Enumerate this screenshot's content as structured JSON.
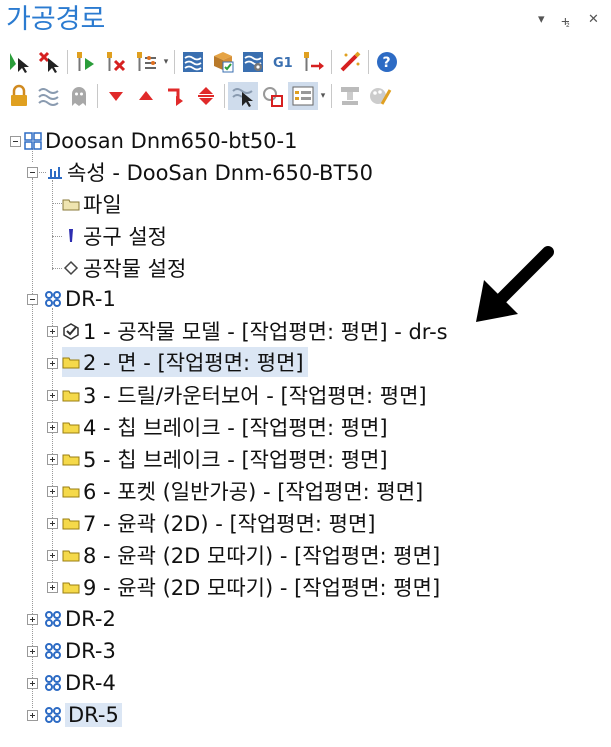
{
  "window": {
    "title": "가공경로",
    "controls": [
      "▾",
      "⨧",
      "✕"
    ]
  },
  "tree": {
    "root": {
      "label": "Doosan Dnm650-bt50-1"
    },
    "properties": {
      "label": "속성 - DooSan Dnm-650-BT50"
    },
    "files": {
      "label": "파일"
    },
    "tool_settings": {
      "label": "공구 설정"
    },
    "stock_settings": {
      "label": "공작물 설정"
    },
    "groups": [
      {
        "label": "DR-1"
      },
      {
        "label": "DR-2"
      },
      {
        "label": "DR-3"
      },
      {
        "label": "DR-4"
      },
      {
        "label": "DR-5"
      }
    ],
    "operations": [
      {
        "label": "1 - 공작물 모델 - [작업평면: 평면] - dr-s"
      },
      {
        "label": "2 - 면 - [작업평면: 평면]"
      },
      {
        "label": "3 - 드릴/카운터보어 - [작업평면: 평면]"
      },
      {
        "label": "4 - 칩 브레이크 - [작업평면: 평면]"
      },
      {
        "label": "5 - 칩 브레이크 - [작업평면: 평면]"
      },
      {
        "label": "6 - 포켓 (일반가공) - [작업평면: 평면]"
      },
      {
        "label": "7 - 윤곽 (2D) - [작업평면: 평면]"
      },
      {
        "label": "8 - 윤곽 (2D 모따기) - [작업평면: 평면]"
      },
      {
        "label": "9 - 윤곽 (2D 모따기) - [작업평면: 평면]"
      }
    ]
  },
  "colors": {
    "title": "#2b7bd0",
    "selection": "#dbe6f4",
    "folder": "#f5d94a"
  }
}
